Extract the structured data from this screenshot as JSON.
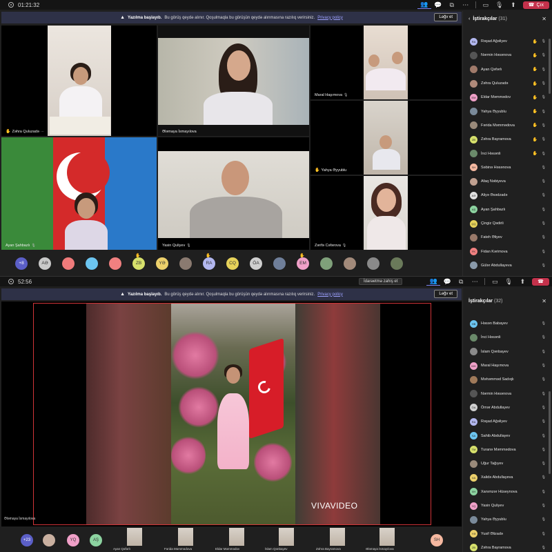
{
  "top": {
    "timer": "01:21:32",
    "banner": {
      "title": "Yazılma başlayıb.",
      "text": "Bu görüş qeydə alınır. Qoşulmaqla bu görüşün qeydə alınmasına razılıq verirsiniz.",
      "policy": "Privacy policy",
      "button": "Ləğv et"
    },
    "leave": "Çıx",
    "tiles": [
      {
        "name": "Zəhra Quluzadə",
        "hand": true
      },
      {
        "name": "Ələmaya İsmayılova",
        "hand": false
      },
      {
        "name": "Maral Haşımova",
        "hand": false
      },
      {
        "name": "Ayan Şahbazlı",
        "hand": false
      },
      {
        "name": "Yasin Quliyev",
        "hand": false
      },
      {
        "name": "Yahya Əyyublu",
        "hand": true
      },
      {
        "name": "Zərifə Cəfərova",
        "hand": false
      }
    ],
    "thumbs": [
      {
        "label": "+8",
        "color": "#5b5fc7",
        "more": true
      },
      {
        "label": "AƏ",
        "color": "#c9c9c9"
      },
      {
        "label": "",
        "color": "#f07b7b"
      },
      {
        "label": "",
        "color": "#6cc5f0"
      },
      {
        "label": "",
        "color": "#f08080"
      },
      {
        "label": "ZB",
        "color": "#d6e06b",
        "hand": true
      },
      {
        "label": "YƏ",
        "color": "#ecd06b"
      },
      {
        "label": "",
        "color": "#8a7a70"
      },
      {
        "label": "RA",
        "color": "#b2b7ef",
        "hand": true
      },
      {
        "label": "CQ",
        "color": "#e6d25a"
      },
      {
        "label": "ÖA",
        "color": "#cfcfcf"
      },
      {
        "label": "",
        "color": "#6f7f9a"
      },
      {
        "label": "EM",
        "color": "#f0a0c8",
        "hand": true
      },
      {
        "label": "",
        "color": "#7fa07a"
      },
      {
        "label": "",
        "color": "#a28a7a"
      },
      {
        "label": "",
        "color": "#8a8a8a"
      },
      {
        "label": "",
        "color": "#6a7a5a"
      }
    ],
    "sidebar": {
      "title": "İştirakçılar",
      "count": "(31)",
      "people": [
        {
          "name": "Rəşad Ağəliyev",
          "initials": "RA",
          "color": "#b2b7ef",
          "hand": true
        },
        {
          "name": "Nərmin Həsənova",
          "initials": "",
          "color": "#555",
          "hand": true
        },
        {
          "name": "Ayan Qəfərlı",
          "initials": "",
          "color": "#a07a6a",
          "hand": true
        },
        {
          "name": "Zəhra Quluzadə",
          "initials": "",
          "color": "#b08a7a",
          "hand": true
        },
        {
          "name": "Eldar Məmmədov",
          "initials": "EM",
          "color": "#f0a0c8",
          "hand": true
        },
        {
          "name": "Yahya Əyyublu",
          "initials": "",
          "color": "#7a8a9a",
          "hand": true
        },
        {
          "name": "Fərida Məmmədova",
          "initials": "",
          "color": "#9a8a7a",
          "hand": true
        },
        {
          "name": "Zəhra Bayramova",
          "initials": "ZB",
          "color": "#d6e06b",
          "hand": true
        },
        {
          "name": "İnci Həsənli",
          "initials": "",
          "color": "#6a8a6a",
          "hand": true
        },
        {
          "name": "Səbinə Həsənova",
          "initials": "SH",
          "color": "#f5b8a0",
          "hand": false
        },
        {
          "name": "Afaq Nəbiyeva",
          "initials": "",
          "color": "#c0a090",
          "hand": false
        },
        {
          "name": "Aliyə Əsədzadə",
          "initials": "AƏ",
          "color": "#e0e0e0",
          "hand": false
        },
        {
          "name": "Ayan Şahbazlı",
          "initials": "AŞ",
          "color": "#8cd3a0",
          "hand": false
        },
        {
          "name": "Çingiz Qədirli",
          "initials": "ÇQ",
          "color": "#e6d25a",
          "hand": false
        },
        {
          "name": "Fateh Əliyev",
          "initials": "",
          "color": "#9a7a6a",
          "hand": false
        },
        {
          "name": "Fidan Kərimova",
          "initials": "FK",
          "color": "#f08080",
          "hand": false
        },
        {
          "name": "Gülər Abdullayeva",
          "initials": "",
          "color": "#8a9aaa",
          "hand": false
        }
      ]
    }
  },
  "bottom": {
    "timer": "52:56",
    "manage": "İdarəetmə zahiş et",
    "banner": {
      "title": "Yazılma başlayıb.",
      "text": "Bu görüş qeydə alınır. Qoşulmaqla bu görüşün qeydə alınmasına razılıq verirsiniz.",
      "policy": "Privacy policy",
      "button": "Ləğv et"
    },
    "main_name": "Ələmaya İsmayılova",
    "watermark": "VIVAVIDEO",
    "thumbs": [
      {
        "label": "+23",
        "color": "#5b5fc7",
        "type": "av"
      },
      {
        "label": "",
        "color": "#c9b0a0",
        "type": "av"
      },
      {
        "label": "YQ",
        "color": "#f0a0c8",
        "type": "av"
      },
      {
        "label": "AŞ",
        "color": "#8cd3a0",
        "type": "av"
      },
      {
        "label": "Ayan Qəfərlı",
        "type": "vid"
      },
      {
        "label": "Fərida Məmmədova",
        "type": "vid"
      },
      {
        "label": "Eldar Məmmədov",
        "type": "vid"
      },
      {
        "label": "İslam Qənbayev",
        "type": "vid"
      },
      {
        "label": "Zəhra Bayramova",
        "type": "vid"
      },
      {
        "label": "Ələmaya İsmayılova",
        "type": "vid"
      },
      {
        "label": "SH",
        "color": "#f5b8a0",
        "type": "av"
      }
    ],
    "sidebar": {
      "title": "İştirakçılar",
      "count": "(32)",
      "people": [
        {
          "name": "Həsən Babayev",
          "initials": "HB",
          "color": "#6cc5f0"
        },
        {
          "name": "İnci Həsənli",
          "initials": "",
          "color": "#6a8a6a"
        },
        {
          "name": "İslam Qənbayev",
          "initials": "",
          "color": "#8a8a8a"
        },
        {
          "name": "Maral Haşımova",
          "initials": "MH",
          "color": "#f0a0c8"
        },
        {
          "name": "Məhəmməd Sadıqlı",
          "initials": "",
          "color": "#a07a5a"
        },
        {
          "name": "Nərmin Həsənova",
          "initials": "",
          "color": "#555"
        },
        {
          "name": "Ömər Abdullayev",
          "initials": "ÖA",
          "color": "#cfcfcf"
        },
        {
          "name": "Rəşad Ağəliyev",
          "initials": "RA",
          "color": "#b2b7ef"
        },
        {
          "name": "Sahib Abdullayev",
          "initials": "SA",
          "color": "#6cc5f0"
        },
        {
          "name": "Turanə Məmmədova",
          "initials": "TM",
          "color": "#d6e06b"
        },
        {
          "name": "Uğur Tağıyev",
          "initials": "",
          "color": "#9a8a7a"
        },
        {
          "name": "Xalidə Abdullayeva",
          "initials": "XA",
          "color": "#ecd06b"
        },
        {
          "name": "Xanımzər Hüseynova",
          "initials": "XH",
          "color": "#8cd3a0"
        },
        {
          "name": "Yasin Quliyev",
          "initials": "YQ",
          "color": "#f0a0c8"
        },
        {
          "name": "Yahya Əyyublu",
          "initials": "",
          "color": "#7a8a9a"
        },
        {
          "name": "Yusif Əlizadə",
          "initials": "YƏ",
          "color": "#ecd06b"
        },
        {
          "name": "Zəhra Bayramova",
          "initials": "ZB",
          "color": "#d6e06b"
        }
      ]
    }
  }
}
